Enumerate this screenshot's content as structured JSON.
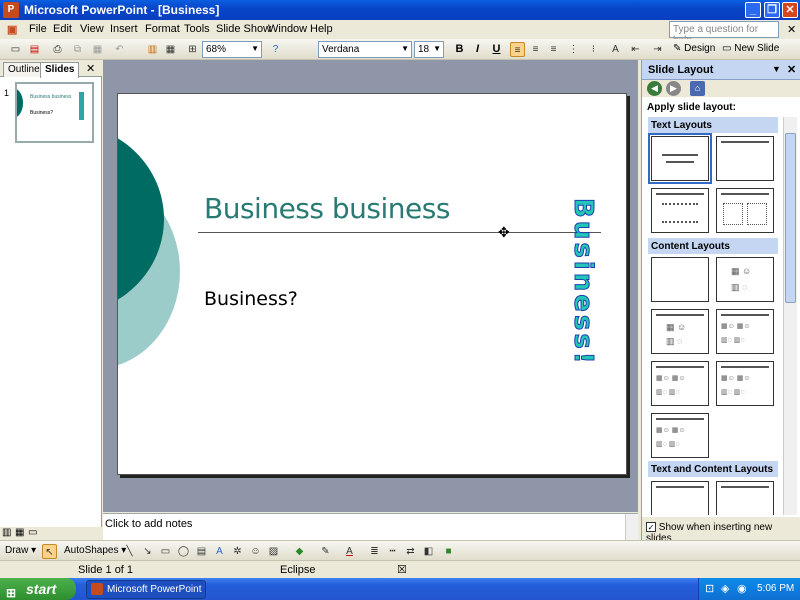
{
  "window": {
    "title": "Microsoft PowerPoint - [Business]"
  },
  "menubar": {
    "items": [
      "File",
      "Edit",
      "View",
      "Insert",
      "Format",
      "Tools",
      "Slide Show",
      "Window",
      "Help"
    ],
    "ask_placeholder": "Type a question for help"
  },
  "toolbar": {
    "zoom": "68%",
    "font": "Verdana",
    "size": "18",
    "design_label": "Design",
    "new_slide_label": "New Slide",
    "bold": "B",
    "italic": "I",
    "underline": "U"
  },
  "left_pane": {
    "tabs": [
      "Outline",
      "Slides"
    ],
    "active_tab": "Slides",
    "thumb_number": "1"
  },
  "slide": {
    "title": "Business business",
    "body": "Business?",
    "wordart": "Business!"
  },
  "notes": {
    "placeholder": "Click to add notes"
  },
  "task_pane": {
    "title": "Slide Layout",
    "apply_label": "Apply slide layout:",
    "sections": [
      "Text Layouts",
      "Content Layouts",
      "Text and Content Layouts"
    ],
    "show_checkbox_label": "Show when inserting new slides",
    "show_checked": true
  },
  "drawbar": {
    "draw_label": "Draw",
    "autoshapes_label": "AutoShapes"
  },
  "statusbar": {
    "slide_info": "Slide 1 of 1",
    "design_name": "Eclipse"
  },
  "taskbar": {
    "start_label": "start",
    "task_item": "Microsoft PowerPoint ...",
    "clock": "5:06 PM"
  },
  "colors": {
    "accent_dark": "#006b62",
    "accent_light": "#9cccc9",
    "title_text": "#2a7a74"
  }
}
